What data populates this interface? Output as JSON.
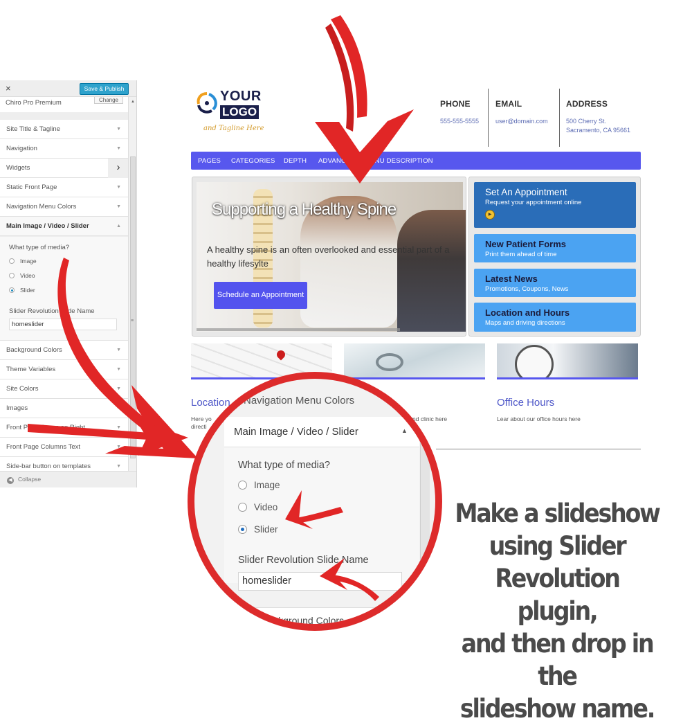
{
  "customizer": {
    "close_icon": "×",
    "save_label": "Save & Publish",
    "theme_name": "Chiro Pro Premium",
    "change_label": "Change",
    "sections": [
      {
        "label": "Site Title & Tagline",
        "arrow": "▼"
      },
      {
        "label": "Navigation",
        "arrow": "▼"
      },
      {
        "label": "Widgets",
        "arrow": "›"
      },
      {
        "label": "Static Front Page",
        "arrow": "▼"
      },
      {
        "label": "Navigation Menu Colors",
        "arrow": "▼"
      },
      {
        "label": "Main Image / Video / Slider",
        "arrow": "▲"
      }
    ],
    "media_question": "What type of media?",
    "media_options": [
      {
        "label": "Image",
        "selected": false
      },
      {
        "label": "Video",
        "selected": false
      },
      {
        "label": "Slider",
        "selected": true
      }
    ],
    "slide_name_label": "Slider Revolution Slide Name",
    "slide_name_value": "homeslider",
    "sections_after": [
      {
        "label": "Background Colors",
        "arrow": "▼"
      },
      {
        "label": "Theme Variables",
        "arrow": "▼"
      },
      {
        "label": "Site Colors",
        "arrow": "▼"
      },
      {
        "label": "Images",
        "arrow": ""
      },
      {
        "label": "Front Page Boxes on Right",
        "arrow": "▼"
      },
      {
        "label": "Front Page Columns Text",
        "arrow": "▼"
      },
      {
        "label": "Side-bar button on templates",
        "arrow": "▼"
      }
    ],
    "collapse_label": "Collapse"
  },
  "site": {
    "logo": {
      "line1": "YOUR",
      "line2": "LOGO",
      "tagline": "and Tagline Here"
    },
    "header": [
      {
        "heading": "PHONE",
        "value": "555-555-5555"
      },
      {
        "heading": "EMAIL",
        "value": "user@domain.com"
      },
      {
        "heading": "ADDRESS",
        "value": "500 Cherry St.",
        "value2": "Sacramento, CA 95661"
      }
    ],
    "nav": [
      "PAGES",
      "CATEGORIES",
      "DEPTH",
      "ADVANCED",
      "MENU DESCRIPTION"
    ],
    "hero": {
      "title": "Supporting a Healthy Spine",
      "text": "A healthy spine is an often overlooked and essential part of a healthy lifesylte",
      "button": "Schedule an Appointment"
    },
    "boxes": [
      {
        "title": "Set An Appointment",
        "subtitle": "Request your appointment online",
        "color": "#2a6db8"
      },
      {
        "title": "New Patient Forms",
        "subtitle": "Print them ahead of time",
        "color": "#4ba3f2"
      },
      {
        "title": "Latest News",
        "subtitle": "Promotions, Coupons, News",
        "color": "#4ba3f2"
      },
      {
        "title": "Location and Hours",
        "subtitle": "Maps and driving directions",
        "color": "#4ba3f2"
      }
    ],
    "columns": [
      {
        "heading": "Location",
        "text": "Here yo",
        "text2": "directi"
      },
      {
        "heading": "",
        "text": "nd clinic here"
      },
      {
        "heading": "Office Hours",
        "text": "Lear about our office hours here"
      }
    ]
  },
  "zoom": {
    "prev_section": "Navigation Menu Colors",
    "section": "Main Image / Video / Slider",
    "question": "What type of media?",
    "options": [
      {
        "label": "Image",
        "selected": false
      },
      {
        "label": "Video",
        "selected": false
      },
      {
        "label": "Slider",
        "selected": true
      }
    ],
    "name_label": "Slider Revolution Slide Name",
    "name_value": "homeslider",
    "next_section": "Background Colors"
  },
  "caption": [
    "Make a slideshow",
    "using Slider",
    "Revolution plugin,",
    "and then drop in the",
    "slideshow name."
  ],
  "colors": {
    "nav": "#5757ee",
    "arrow": "#dd2b2b",
    "accent_blue": "#4ba3f2"
  }
}
